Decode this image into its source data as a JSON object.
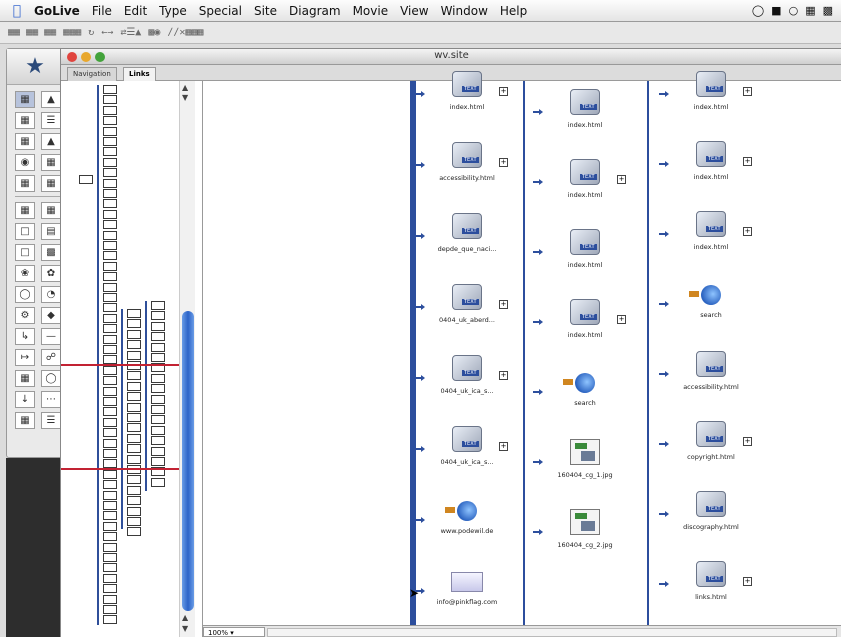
{
  "menubar": {
    "items": [
      "GoLive",
      "File",
      "Edit",
      "Type",
      "Special",
      "Site",
      "Diagram",
      "Movie",
      "View",
      "Window",
      "Help"
    ]
  },
  "window": {
    "title": "wv.site",
    "tabs": [
      "Navigation",
      "Links"
    ]
  },
  "zoom": "100%",
  "columns": {
    "col1": [
      "index.html",
      "accessibility.html",
      "depde_que_naci...",
      "0404_uk_aberd...",
      "0404_uk_ica_s...",
      "0404_uk_ica_s...",
      "www.podewil.de",
      "info@pinkflag.com"
    ],
    "col2": [
      "index.html",
      "index.html",
      "index.html",
      "index.html",
      "search",
      "160404_cg_1.jpg",
      "160404_cg_2.jpg"
    ],
    "col3": [
      "index.html",
      "index.html",
      "index.html",
      "search",
      "accessibility.html",
      "copyright.html",
      "discography.html",
      "links.html"
    ]
  },
  "icons": {
    "page": "html-page-icon",
    "link": "external-link-icon",
    "image": "image-file-icon",
    "mail": "mail-link-icon"
  },
  "colors": {
    "link_lines": "#2c4e9d",
    "highlight_lines": "#c22233",
    "scroll_thumb": "#2d63c8"
  }
}
